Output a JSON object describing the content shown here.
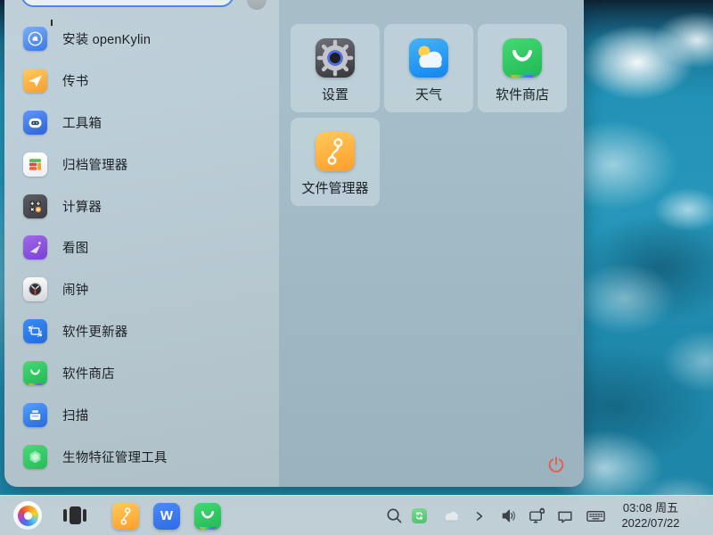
{
  "colors": {
    "accent_blue": "#4a86e8",
    "power_red": "#e4604e",
    "panel_gray": "#b7c7d0",
    "taskbar_gray": "#c7d1d6"
  },
  "start_menu": {
    "search": {
      "value": "",
      "placeholder": ""
    },
    "apps": [
      {
        "label": "安装 openKylin",
        "icon": "openkylin-installer-icon"
      },
      {
        "label": "传书",
        "icon": "messenger-icon"
      },
      {
        "label": "工具箱",
        "icon": "toolbox-icon"
      },
      {
        "label": "归档管理器",
        "icon": "archive-manager-icon"
      },
      {
        "label": "计算器",
        "icon": "calculator-icon"
      },
      {
        "label": "看图",
        "icon": "image-viewer-icon"
      },
      {
        "label": "闹钟",
        "icon": "alarm-clock-icon"
      },
      {
        "label": "软件更新器",
        "icon": "software-updater-icon"
      },
      {
        "label": "软件商店",
        "icon": "app-store-icon"
      },
      {
        "label": "扫描",
        "icon": "scanner-icon"
      },
      {
        "label": "生物特征管理工具",
        "icon": "biometric-tool-icon"
      }
    ],
    "tiles": [
      {
        "label": "设置",
        "icon": "settings-icon"
      },
      {
        "label": "天气",
        "icon": "weather-icon"
      },
      {
        "label": "软件商店",
        "icon": "app-store-icon"
      },
      {
        "label": "文件管理器",
        "icon": "file-manager-icon"
      }
    ],
    "power_icon": "power-icon"
  },
  "taskbar": {
    "start_icon": "openkylin-logo-icon",
    "pinned": [
      {
        "icon": "multitask-view-icon"
      },
      {
        "icon": "file-manager-icon"
      },
      {
        "icon": "wps-office-icon",
        "glyph": "W"
      },
      {
        "icon": "app-store-icon"
      }
    ],
    "tray": [
      "search-icon",
      "software-update-icon",
      "weather-cloud-icon",
      "expand-chevron-icon",
      "volume-icon",
      "display-device-icon",
      "messages-icon",
      "input-method-icon"
    ],
    "clock": {
      "time": "03:08 周五",
      "date": "2022/07/22"
    }
  }
}
